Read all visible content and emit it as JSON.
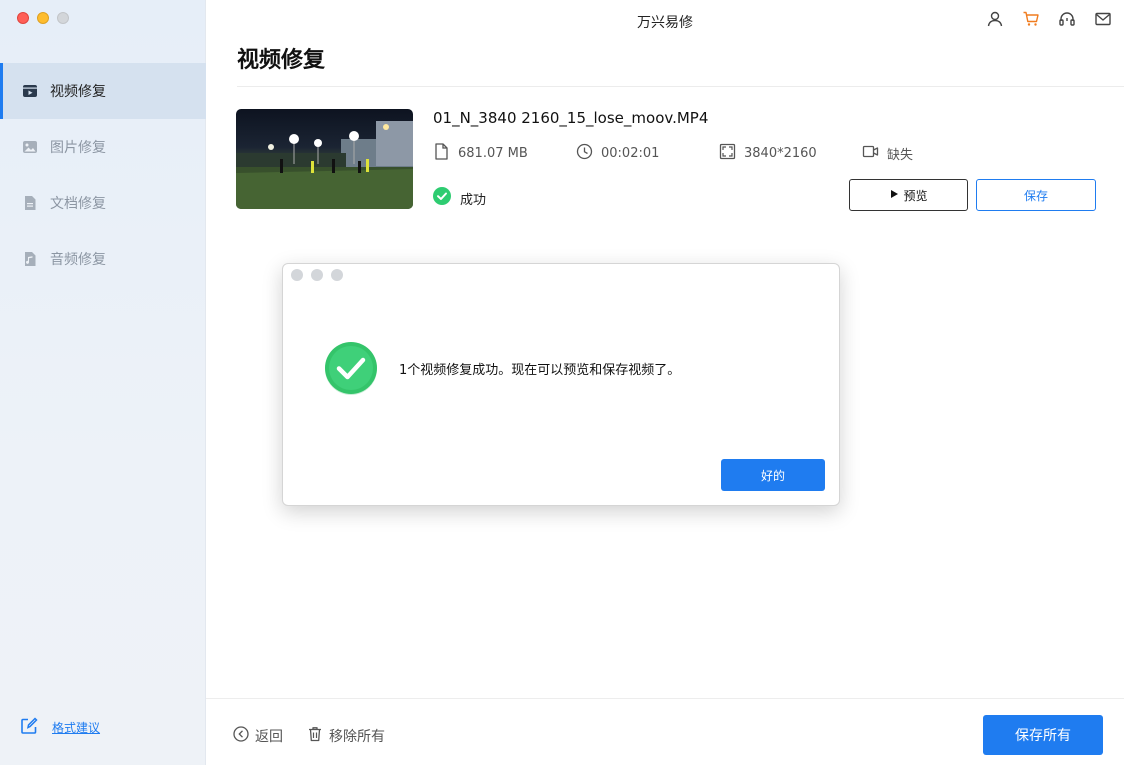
{
  "window": {
    "title": "万兴易修"
  },
  "sidebar": {
    "items": [
      {
        "label": "视频修复",
        "icon": "video-icon",
        "active": true
      },
      {
        "label": "图片修复",
        "icon": "image-icon",
        "active": false
      },
      {
        "label": "文档修复",
        "icon": "document-icon",
        "active": false
      },
      {
        "label": "音频修复",
        "icon": "audio-icon",
        "active": false
      }
    ],
    "feedback": {
      "label": "格式建议",
      "icon": "edit-icon"
    }
  },
  "header": {
    "icons": [
      "user-icon",
      "cart-icon",
      "headset-icon",
      "mail-icon"
    ]
  },
  "page": {
    "title": "视频修复"
  },
  "file": {
    "name": "01_N_3840 2160_15_lose_moov.MP4",
    "size": "681.07 MB",
    "duration": "00:02:01",
    "resolution": "3840*2160",
    "camera": "缺失",
    "status": "成功",
    "preview_label": "预览",
    "save_label": "保存"
  },
  "footer": {
    "back_label": "返回",
    "remove_all_label": "移除所有",
    "save_all_label": "保存所有"
  },
  "dialog": {
    "message": "1个视频修复成功。现在可以预览和保存视频了。",
    "ok_label": "好的"
  },
  "colors": {
    "accent": "#1f7cf0",
    "success": "#2ecc71",
    "cart": "#f07c1f"
  }
}
